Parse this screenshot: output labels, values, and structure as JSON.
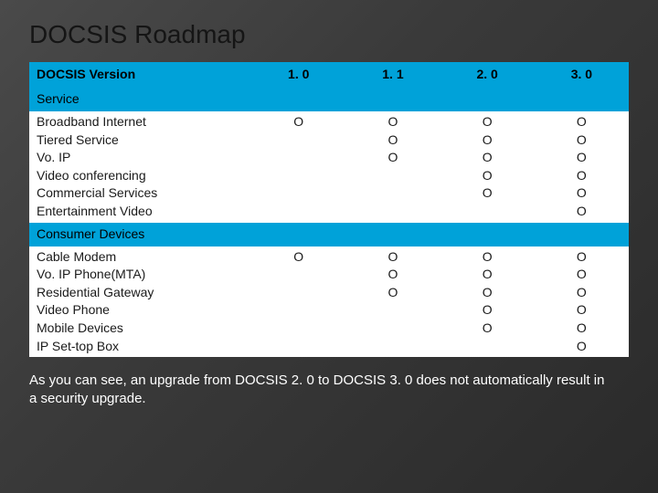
{
  "title": "DOCSIS Roadmap",
  "columns_header": "DOCSIS Version",
  "versions": [
    "1. 0",
    "1. 1",
    "2. 0",
    "3. 0"
  ],
  "sections": [
    {
      "name": "Service",
      "items": [
        "Broadband Internet",
        "Tiered Service",
        "Vo. IP",
        "Video conferencing",
        "Commercial Services",
        "Entertainment Video"
      ],
      "marks": [
        [
          "O",
          "",
          "",
          "",
          "",
          ""
        ],
        [
          "O",
          "O",
          "O",
          "",
          "",
          ""
        ],
        [
          "O",
          "O",
          "O",
          "O",
          "O",
          ""
        ],
        [
          "O",
          "O",
          "O",
          "O",
          "O",
          "O"
        ]
      ]
    },
    {
      "name": "Consumer Devices",
      "items": [
        "Cable Modem",
        "Vo. IP Phone(MTA)",
        "Residential Gateway",
        "Video Phone",
        "Mobile Devices",
        "IP Set-top Box"
      ],
      "marks": [
        [
          "O",
          "",
          "",
          "",
          "",
          ""
        ],
        [
          "O",
          "O",
          "O",
          "",
          "",
          ""
        ],
        [
          "O",
          "O",
          "O",
          "O",
          "O",
          ""
        ],
        [
          "O",
          "O",
          "O",
          "O",
          "O",
          "O"
        ]
      ]
    }
  ],
  "caption": "As you can see, an upgrade from DOCSIS 2. 0 to DOCSIS 3. 0 does not automatically result in a security upgrade.",
  "chart_data": {
    "type": "table",
    "title": "DOCSIS Roadmap",
    "columns": [
      "DOCSIS Version",
      "1.0",
      "1.1",
      "2.0",
      "3.0"
    ],
    "sections": [
      {
        "name": "Service",
        "rows": [
          {
            "label": "Broadband Internet",
            "1.0": "O",
            "1.1": "O",
            "2.0": "O",
            "3.0": "O"
          },
          {
            "label": "Tiered Service",
            "1.0": "",
            "1.1": "O",
            "2.0": "O",
            "3.0": "O"
          },
          {
            "label": "VoIP",
            "1.0": "",
            "1.1": "O",
            "2.0": "O",
            "3.0": "O"
          },
          {
            "label": "Video conferencing",
            "1.0": "",
            "1.1": "",
            "2.0": "O",
            "3.0": "O"
          },
          {
            "label": "Commercial Services",
            "1.0": "",
            "1.1": "",
            "2.0": "O",
            "3.0": "O"
          },
          {
            "label": "Entertainment Video",
            "1.0": "",
            "1.1": "",
            "2.0": "",
            "3.0": "O"
          }
        ]
      },
      {
        "name": "Consumer Devices",
        "rows": [
          {
            "label": "Cable Modem",
            "1.0": "O",
            "1.1": "O",
            "2.0": "O",
            "3.0": "O"
          },
          {
            "label": "VoIP Phone (MTA)",
            "1.0": "",
            "1.1": "O",
            "2.0": "O",
            "3.0": "O"
          },
          {
            "label": "Residential Gateway",
            "1.0": "",
            "1.1": "O",
            "2.0": "O",
            "3.0": "O"
          },
          {
            "label": "Video Phone",
            "1.0": "",
            "1.1": "",
            "2.0": "O",
            "3.0": "O"
          },
          {
            "label": "Mobile Devices",
            "1.0": "",
            "1.1": "",
            "2.0": "O",
            "3.0": "O"
          },
          {
            "label": "IP Set-top Box",
            "1.0": "",
            "1.1": "",
            "2.0": "",
            "3.0": "O"
          }
        ]
      }
    ]
  }
}
